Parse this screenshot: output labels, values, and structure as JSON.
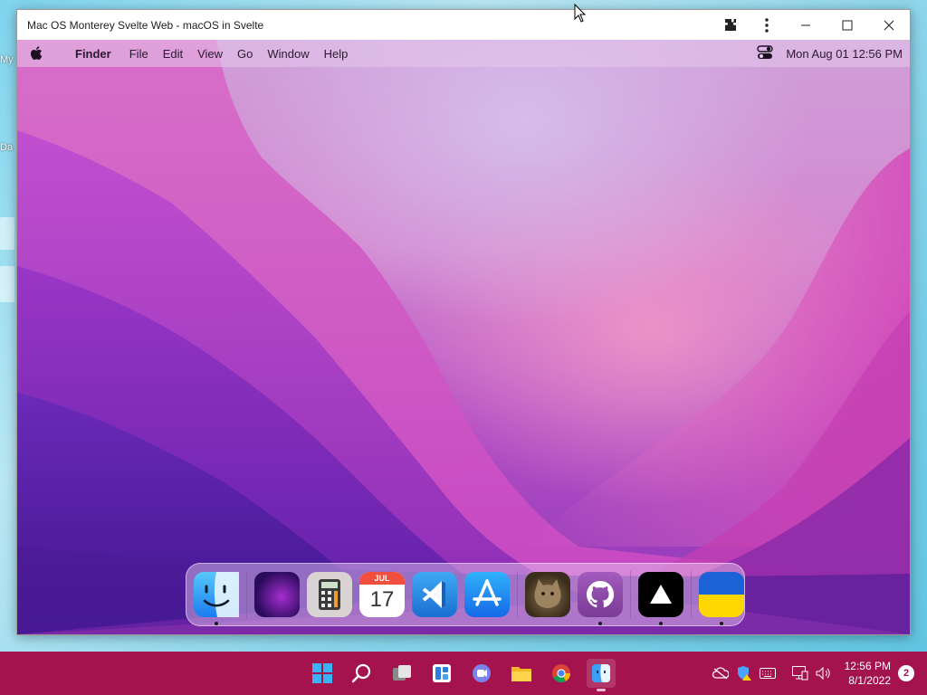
{
  "desktop": {
    "labels": [
      "My",
      "Da"
    ]
  },
  "window": {
    "title": "Mac OS Monterey Svelte Web - macOS in Svelte",
    "controls": [
      "extensions-icon",
      "more-icon",
      "minimize-icon",
      "maximize-icon",
      "close-icon"
    ]
  },
  "menubar": {
    "app_name": "Finder",
    "items": [
      "File",
      "Edit",
      "View",
      "Go",
      "Window",
      "Help"
    ],
    "datetime": "Mon Aug 01  12:56 PM"
  },
  "dock": {
    "apps": [
      {
        "name": "Finder",
        "icon": "finder-icon",
        "running": true
      },
      {
        "name": "Wallpapers",
        "icon": "wallpaper-icon",
        "running": false
      },
      {
        "name": "Calculator",
        "icon": "calculator-icon",
        "running": false
      },
      {
        "name": "Calendar",
        "icon": "calendar-icon",
        "running": false,
        "month": "JUL",
        "day": "17"
      },
      {
        "name": "VS Code",
        "icon": "vscode-icon",
        "running": false
      },
      {
        "name": "App Store",
        "icon": "appstore-icon",
        "running": false
      },
      {
        "name": "Cat",
        "icon": "cat-photo-icon",
        "running": false
      },
      {
        "name": "GitHub",
        "icon": "github-icon",
        "running": true
      },
      {
        "name": "Vercel",
        "icon": "vercel-icon",
        "running": true
      },
      {
        "name": "Ukraine",
        "icon": "ukraine-flag-icon",
        "running": true
      }
    ]
  },
  "taskbar": {
    "apps": [
      "windows-start-icon",
      "search-icon",
      "task-view-icon",
      "widgets-icon",
      "teams-chat-icon",
      "file-explorer-icon",
      "chrome-icon",
      "finder-app-icon"
    ],
    "time": "12:56 PM",
    "date": "8/1/2022",
    "notifications": "2"
  },
  "colors": {
    "taskbar": "#a5134e",
    "window_bg": "#ffffff"
  }
}
